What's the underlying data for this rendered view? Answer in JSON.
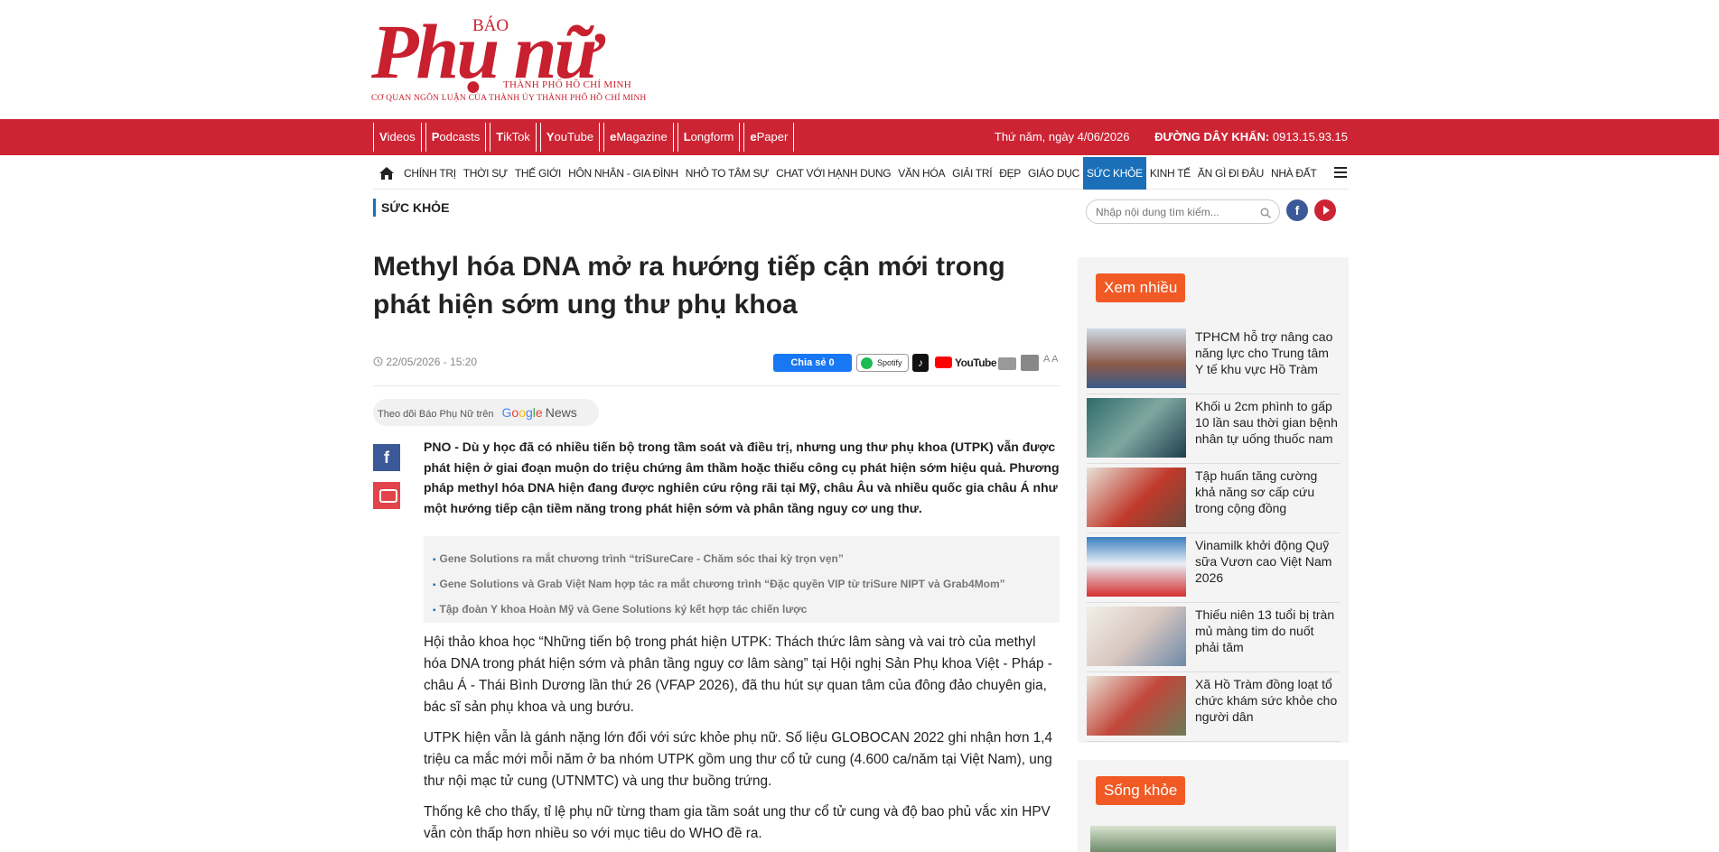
{
  "logo": {
    "bao": "BÁO",
    "main": "Phụ nữ",
    "city": "THÀNH PHỐ HỒ CHÍ MINH",
    "org": "CƠ QUAN NGÔN LUẬN CỦA THÀNH ỦY THÀNH PHỐ HỒ CHÍ MINH"
  },
  "topbar": {
    "items": [
      {
        "first": "V",
        "rest": "ideos"
      },
      {
        "first": "P",
        "rest": "odcasts"
      },
      {
        "first": "T",
        "rest": "ikTok"
      },
      {
        "first": "Y",
        "rest": "ouTube"
      },
      {
        "first": "e",
        "rest": "Magazine"
      },
      {
        "first": "L",
        "rest": "ongform"
      },
      {
        "first": "e",
        "rest": "Paper"
      }
    ],
    "date": "Thứ năm, ngày 4/06/2026",
    "hotline_label": "ĐƯỜNG DÂY KHẨN:",
    "hotline_number": "0913.15.93.15"
  },
  "nav": {
    "items": [
      "CHÍNH TRỊ",
      "THỜI SỰ",
      "THẾ GIỚI",
      "HÔN NHÂN - GIA ĐÌNH",
      "NHỎ TO TÂM SỰ",
      "CHAT VỚI HẠNH DUNG",
      "VĂN HÓA",
      "GIẢI TRÍ",
      "ĐẸP",
      "GIÁO DỤC",
      "SỨC KHỎE",
      "KINH TẾ",
      "ĂN GÌ ĐI ĐÂU",
      "NHÀ ĐẤT"
    ],
    "active": "SỨC KHỎE"
  },
  "section": "SỨC KHỎE",
  "search": {
    "placeholder": "Nhập nội dung tìm kiếm..."
  },
  "article": {
    "title": "Methyl hóa DNA mở ra hướng tiếp cận mới trong phát hiện sớm ung thư phụ khoa",
    "date": "22/05/2026 - 15:20",
    "share_label": "Chia sẻ 0",
    "spotify_label": "Spotify",
    "youtube_label": "YouTube",
    "font_label": "A A",
    "gnews_label": "Theo dõi Báo Phụ Nữ trên",
    "gnews_brand": "News",
    "sapo": "PNO - Dù y học đã có nhiều tiến bộ trong tầm soát và điều trị, nhưng ung thư phụ khoa (UTPK) vẫn được phát hiện ở giai đoạn muộn do triệu chứng âm thầm hoặc thiếu công cụ phát hiện sớm hiệu quả. Phương pháp methyl hóa DNA hiện đang được nghiên cứu rộng rãi tại Mỹ, châu Âu và nhiều quốc gia châu Á như một hướng tiếp cận tiềm năng trong phát hiện sớm và phân tầng nguy cơ ung thư.",
    "related": [
      "Gene Solutions ra mắt chương trình “triSureCare - Chăm sóc thai kỳ trọn vẹn”",
      "Gene Solutions và Grab Việt Nam hợp tác ra mắt chương trình “Đặc quyền VIP từ triSure NIPT và Grab4Mom”",
      "Tập đoàn Y khoa Hoàn Mỹ và Gene Solutions ký kết hợp tác chiến lược"
    ],
    "paragraphs": [
      "Hội thảo khoa học “Những tiến bộ trong phát hiện UTPK: Thách thức lâm sàng và vai trò của methyl hóa DNA trong phát hiện sớm và phân tầng nguy cơ lâm sàng” tại Hội nghị Sản Phụ khoa Việt - Pháp - châu Á - Thái Bình Dương lần thứ 26 (VFAP 2026), đã thu hút sự quan tâm của đông đảo chuyên gia, bác sĩ sản phụ khoa và ung bướu.",
      "UTPK hiện vẫn là gánh nặng lớn đối với sức khỏe phụ nữ. Số liệu GLOBOCAN 2022 ghi nhận hơn 1,4 triệu ca mắc mới mỗi năm ở ba nhóm UTPK gồm ung thư cổ tử cung (4.600 ca/năm tại Việt Nam), ung thư nội mạc tử cung (UTNMTC) và ung thư buồng trứng.",
      "Thống kê cho thấy, tỉ lệ phụ nữ từng tham gia tầm soát ung thư cổ tử cung và độ bao phủ vắc xin HPV vẫn còn thấp hơn nhiều so với mục tiêu do WHO đề ra."
    ]
  },
  "sidebar": {
    "tag": "Xem nhiều",
    "items": [
      {
        "text": "TPHCM hỗ trợ nâng cao năng lực cho Trung tâm Y tế khu vực Hồ Tràm"
      },
      {
        "text": "Khối u 2cm phình to gấp 10 lần sau thời gian bệnh nhân tự uống thuốc nam"
      },
      {
        "text": "Tập huấn tăng cường khả năng sơ cấp cứu trong cộng đồng"
      },
      {
        "text": "Vinamilk khởi động Quỹ sữa Vươn cao Việt Nam 2026"
      },
      {
        "text": "Thiếu niên 13 tuổi bị tràn mủ màng tim do nuốt phải tăm"
      },
      {
        "text": "Xã Hồ Tràm đồng loạt tổ chức khám sức khỏe cho người dân"
      }
    ],
    "tag2": "Sống khỏe"
  },
  "colors": {
    "brand_red": "#cd2434",
    "nav_active": "#1a6fb8",
    "tag_orange": "#f15a24"
  }
}
